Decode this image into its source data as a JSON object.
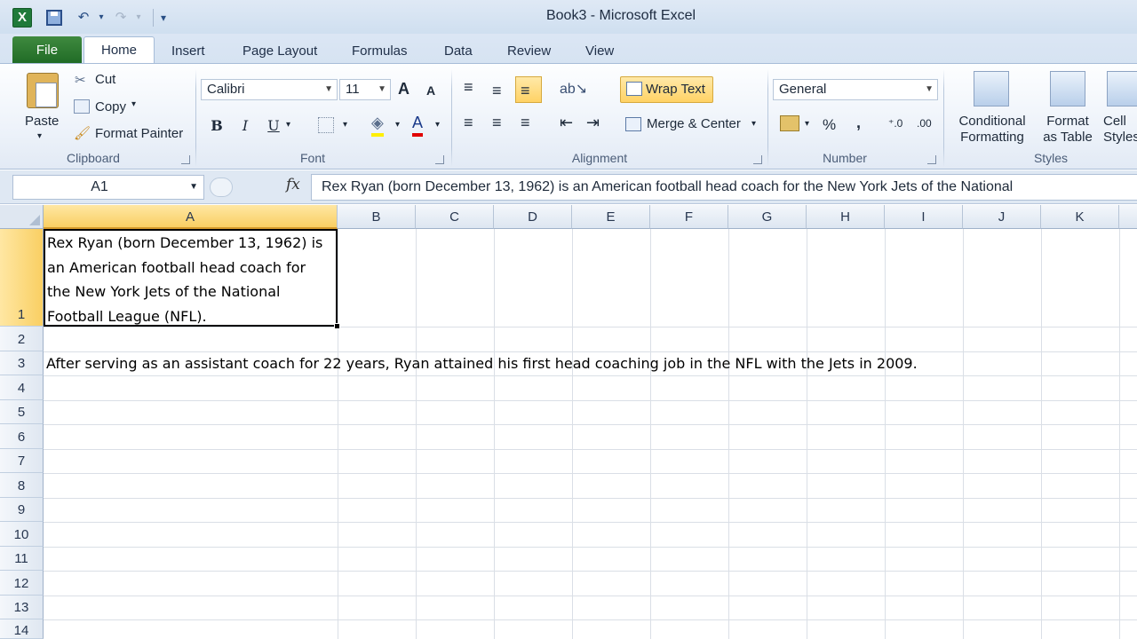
{
  "window": {
    "title": "Book3  -  Microsoft Excel",
    "app_icon": "X"
  },
  "quick_access": {
    "undo": "↶",
    "redo": "↷",
    "customize": "▾"
  },
  "tabs": [
    {
      "label": "File"
    },
    {
      "label": "Home"
    },
    {
      "label": "Insert"
    },
    {
      "label": "Page Layout"
    },
    {
      "label": "Formulas"
    },
    {
      "label": "Data"
    },
    {
      "label": "Review"
    },
    {
      "label": "View"
    }
  ],
  "ribbon": {
    "clipboard": {
      "label": "Clipboard",
      "paste": "Paste",
      "cut": "Cut",
      "copy": "Copy",
      "format_painter": "Format Painter"
    },
    "font": {
      "label": "Font",
      "name": "Calibri",
      "size": "11",
      "bold": "B",
      "italic": "I",
      "underline": "U",
      "grow": "A",
      "shrink": "A",
      "color_letter": "A"
    },
    "alignment": {
      "label": "Alignment",
      "wrap_text": "Wrap Text",
      "merge_center": "Merge & Center"
    },
    "number": {
      "label": "Number",
      "format": "General",
      "percent": "%",
      "comma": ","
    },
    "styles": {
      "label": "Styles",
      "conditional_1": "Conditional",
      "conditional_2": "Formatting",
      "format_table_1": "Format",
      "format_table_2": "as Table",
      "cell_styles_1": "Cell",
      "cell_styles_2": "Styles"
    }
  },
  "formula_bar": {
    "name_box": "A1",
    "fx": "fx",
    "content": "Rex Ryan (born December 13, 1962) is an American football head coach for the New York Jets of the National"
  },
  "columns": [
    "A",
    "B",
    "C",
    "D",
    "E",
    "F",
    "G",
    "H",
    "I",
    "J",
    "K"
  ],
  "rows": [
    "1",
    "2",
    "3",
    "4",
    "5",
    "6",
    "7",
    "8",
    "9",
    "10",
    "11",
    "12",
    "13",
    "14"
  ],
  "cells": {
    "A1_lines": [
      "Rex Ryan (born December 13, 1962) is",
      "an American football head coach for",
      "the New York Jets of the National",
      "Football League (NFL)."
    ],
    "A3": "After serving as an assistant coach for 22 years, Ryan attained his first head coaching job in the NFL with the Jets in 2009."
  },
  "colors": {
    "accent_selected": "#f9cf63",
    "file_tab": "#2a7a2e"
  }
}
